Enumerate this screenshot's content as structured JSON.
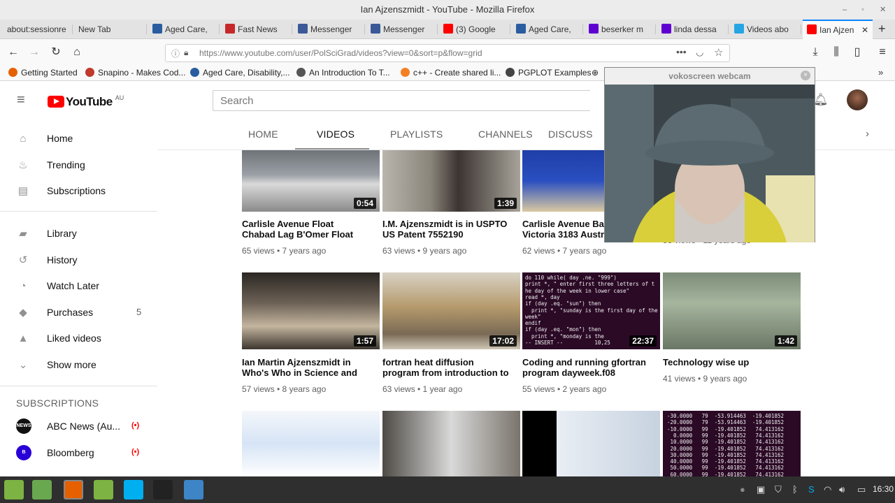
{
  "window": {
    "title": "Ian Ajzenszmidt - YouTube - Mozilla Firefox"
  },
  "tabs": [
    {
      "label": "about:sessionre",
      "icon": "blank-icon",
      "color": "#e3e3e3"
    },
    {
      "label": "New Tab",
      "icon": "blank-icon",
      "color": "#e3e3e3"
    },
    {
      "label": "Aged Care, ",
      "icon": "star-icon",
      "color": "#2a5d9f"
    },
    {
      "label": "Fast News",
      "icon": "flag-icon",
      "color": "#c62828"
    },
    {
      "label": "Messenger",
      "icon": "facebook-icon",
      "color": "#3b5998"
    },
    {
      "label": "Messenger",
      "icon": "facebook-icon",
      "color": "#3b5998"
    },
    {
      "label": "(3) Google",
      "icon": "youtube-icon",
      "color": "#ff0000"
    },
    {
      "label": "Aged Care, ",
      "icon": "star-icon",
      "color": "#2a5d9f"
    },
    {
      "label": "beserker m",
      "icon": "yahoo-icon",
      "color": "#5f01d1"
    },
    {
      "label": "linda dessa",
      "icon": "yahoo-icon",
      "color": "#5f01d1"
    },
    {
      "label": "Videos abo",
      "icon": "videos-icon",
      "color": "#26a5e4"
    },
    {
      "label": "Ian Ajzen",
      "icon": "youtube-icon",
      "color": "#ff0000",
      "active": true
    }
  ],
  "nav": {
    "url": "https://www.youtube.com/user/PolSciGrad/videos?view=0&sort=p&flow=grid"
  },
  "bookmarks": [
    {
      "label": "Getting Started",
      "color": "#e66000"
    },
    {
      "label": "Snapino - Makes Cod...",
      "color": "#c0392b"
    },
    {
      "label": "Aged Care, Disability,...",
      "color": "#2a5d9f"
    },
    {
      "label": "An Introduction To T...",
      "color": "#555555"
    },
    {
      "label": "c++ - Create shared li...",
      "color": "#f48024"
    },
    {
      "label": "PGPLOT Examples",
      "color": "#444444"
    }
  ],
  "youtube": {
    "logo_text": "YouTube",
    "region": "AU",
    "search_placeholder": "Search"
  },
  "sidebar": {
    "primary": [
      {
        "label": "Home",
        "icon": "home-icon",
        "glyph": "⌂"
      },
      {
        "label": "Trending",
        "icon": "flame-icon",
        "glyph": "♨"
      },
      {
        "label": "Subscriptions",
        "icon": "subscriptions-icon",
        "glyph": "▤"
      }
    ],
    "library": [
      {
        "label": "Library",
        "icon": "folder-icon",
        "glyph": "▰"
      },
      {
        "label": "History",
        "icon": "history-icon",
        "glyph": "↺"
      },
      {
        "label": "Watch Later",
        "icon": "clock-icon",
        "glyph": "◔"
      },
      {
        "label": "Purchases",
        "icon": "tag-icon",
        "glyph": "◆",
        "count": "5"
      },
      {
        "label": "Liked videos",
        "icon": "thumbs-up-icon",
        "glyph": "▲"
      },
      {
        "label": "Show more",
        "icon": "chevron-down-icon",
        "glyph": "⌄"
      }
    ],
    "subscriptions_heading": "SUBSCRIPTIONS",
    "subscriptions": [
      {
        "label": "ABC News (Au...",
        "avatar_color": "#111111",
        "avatar_text": "NEWS"
      },
      {
        "label": "Bloomberg",
        "avatar_color": "#2800d7",
        "avatar_text": "B"
      }
    ]
  },
  "channel_tabs": [
    "HOME",
    "VIDEOS",
    "PLAYLISTS",
    "CHANNELS",
    "DISCUSS"
  ],
  "videos": [
    {
      "title_1": "Carlisle Avenue Float",
      "title_2": "Chabad Lag B'Omer Float",
      "meta": "65 views • 7 years ago",
      "duration": "0:54",
      "thumb": "linear-gradient(180deg,#6e7378 0%,#9aa0a6 40%,#d9d9d9 55%,#8a8a8a 100%)"
    },
    {
      "title_1": "I.M. Ajzenszmidt is in USPTO",
      "title_2": "US Patent 7552190",
      "meta": "63 views • 9 years ago",
      "duration": "1:39",
      "thumb": "linear-gradient(90deg,#b9b5ad 0%,#8a857b 35%,#3b3431 55%,#a8a39a 100%)"
    },
    {
      "title_1": "Carlisle Avenue Bal",
      "title_2": "Victoria 3183 Austr",
      "meta": "62 views • 7 years ago",
      "duration": "",
      "thumb": "linear-gradient(180deg,#1f3fa8 0%,#2a4fc0 50%,#d9c9a1 100%)"
    },
    {
      "title_1": "",
      "title_2": "",
      "meta": "58 views • 11 years ago",
      "duration": "",
      "thumb": "#ffffff"
    },
    {
      "title_1": "Ian Martin Ajzenszmidt in",
      "title_2": "Who's Who in Science and",
      "meta": "57 views • 8 years ago",
      "duration": "1:57",
      "thumb": "linear-gradient(180deg,#2b2723 0%,#6d6256 40%,#c3b59e 70%,#3d362f 100%)"
    },
    {
      "title_1": "fortran heat diffusion",
      "title_2": "program from introduction to",
      "meta": "63 views • 1 year ago",
      "duration": "17:02",
      "thumb": "linear-gradient(180deg,#d8d2c4 0%,#b59a6c 45%,#7a6a55 80%,#cfc6b5 100%)"
    },
    {
      "title_1": "Coding and running gfortran",
      "title_2": "program dayweek.f08",
      "meta": "55 views • 2 years ago",
      "duration": "22:37",
      "thumb": "#2b0a26"
    },
    {
      "title_1": "Technology wise up",
      "title_2": "",
      "meta": "41 views • 9 years ago",
      "duration": "1:42",
      "thumb": "linear-gradient(180deg,#7d8c78 0%,#a6b59e 40%,#6a7765 100%)"
    },
    {
      "title_1": "",
      "title_2": "",
      "meta": "",
      "duration": "",
      "thumb": "linear-gradient(180deg,#f4f7fb 0%,#d6e4f5 50%,#ffffff 100%)"
    },
    {
      "title_1": "",
      "title_2": "",
      "meta": "",
      "duration": "",
      "thumb": "linear-gradient(90deg,#4e4a45 0%,#d9d9d9 50%,#7a746c 100%)"
    },
    {
      "title_1": "",
      "title_2": "",
      "meta": "",
      "duration": "",
      "thumb": "linear-gradient(90deg,#000000 0%,#000000 25%,#e9eef4 25%,#c7d2e0 100%)"
    },
    {
      "title_1": "",
      "title_2": "",
      "meta": "",
      "duration": "",
      "thumb": "#2b0a26"
    }
  ],
  "code_thumb_lines": [
    "do 110 while( day .ne. \"999\")",
    "print *, \" enter first three letters of t",
    "he day of the week in lower case\"",
    "read *, day",
    "if (day .eq. \"sun\") then",
    "  print *, \"sunday is the first day of the",
    "week\"",
    "endif",
    "if (day .eq. \"mon\") then",
    "  print *, \"monday is the",
    "-- INSERT --          10,25"
  ],
  "numbers_thumb_lines": [
    "-30.0000   79  -53.914463  -19.401852",
    "-20.0000   79  -53.914463  -19.401852",
    "-10.0000   99  -19.401852   74.413162",
    "  0.0000   99  -19.401852   74.413162",
    " 10.0000   99  -19.401852   74.413162",
    " 20.0000   99  -19.401852   74.413162",
    " 30.0000   99  -19.401852   74.413162",
    " 40.0000   99  -19.401852   74.413162",
    " 50.0000   99  -19.401852   74.413162",
    " 60.0000   99  -19.401852   74.413162"
  ],
  "webcam": {
    "title": "vokoscreen webcam"
  },
  "taskbar": {
    "clock": "16:30",
    "apps": [
      {
        "name": "mint-menu-icon",
        "color": "#7cb342"
      },
      {
        "name": "files-icon",
        "color": "#6aa84f"
      },
      {
        "name": "firefox-icon",
        "color": "#e66000"
      },
      {
        "name": "folder-icon",
        "color": "#7cb342"
      },
      {
        "name": "skype-icon",
        "color": "#00aff0"
      },
      {
        "name": "terminal-icon",
        "color": "#222222"
      },
      {
        "name": "screen-recorder-icon",
        "color": "#3d85c6"
      }
    ]
  }
}
